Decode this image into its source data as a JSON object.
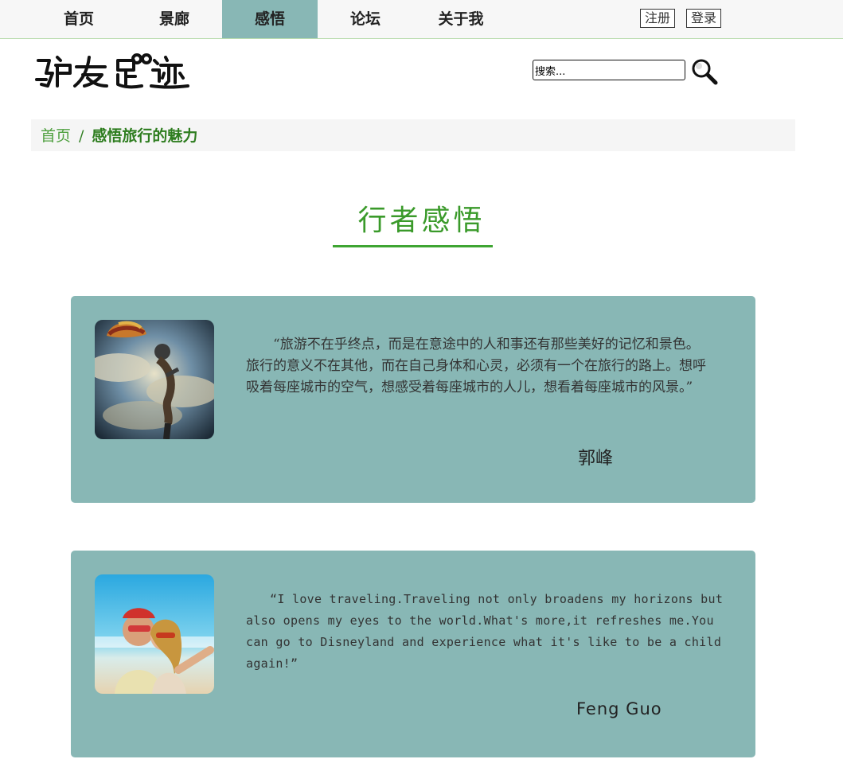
{
  "nav": {
    "items": [
      {
        "label": "首页"
      },
      {
        "label": "景廊"
      },
      {
        "label": "感悟"
      },
      {
        "label": "论坛"
      },
      {
        "label": "关于我"
      }
    ],
    "active_index": 2,
    "register_label": "注册",
    "login_label": "登录"
  },
  "header": {
    "logo_text": "驴友足迹",
    "search": {
      "value": "搜索...",
      "placeholder": "搜索..."
    },
    "search_icon": "search-icon"
  },
  "breadcrumb": {
    "home": "首页",
    "separator": "/",
    "current": "感悟旅行的魅力"
  },
  "section": {
    "title": "行者感悟"
  },
  "cards": [
    {
      "quote": "“旅游不在乎终点，而是在意途中的人和事还有那些美好的记忆和景色。旅行的意义不在其他，而在自己身体和心灵，必须有一个在旅行的路上。想呼吸着每座城市的空气，想感受着每座城市的人儿，想看着每座城市的风景。”",
      "author": "郭峰",
      "avatar_subject": "hot-air-balloon-astronaut"
    },
    {
      "quote": "“I love traveling.Traveling not only broadens my horizons but also opens my eyes to the world.What's more,it refreshes me.You can go to Disneyland and experience what it's like to be a child again!”",
      "author": "Feng Guo",
      "avatar_subject": "beach-selfie-couple"
    }
  ],
  "colors": {
    "accent_green": "#3ea532",
    "card_teal": "#88b7b5",
    "nav_active": "#88b7b5"
  }
}
